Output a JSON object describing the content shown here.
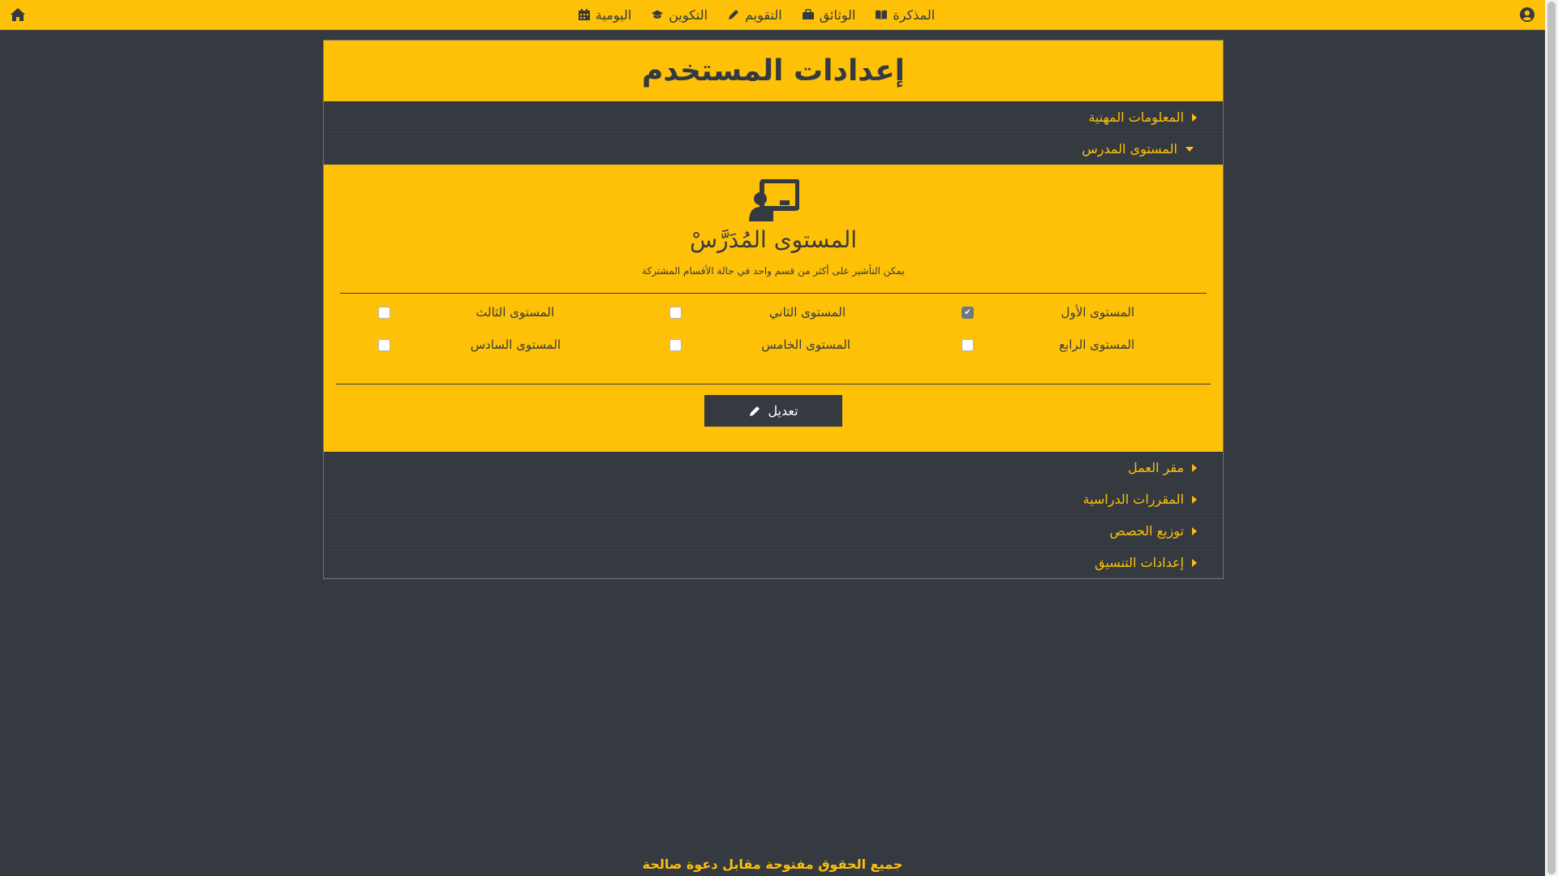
{
  "navbar": {
    "items": [
      {
        "label": "المذكرة",
        "icon": "book-icon"
      },
      {
        "label": "الوثائق",
        "icon": "briefcase-icon"
      },
      {
        "label": "التقويم",
        "icon": "pencil-icon"
      },
      {
        "label": "التكوين",
        "icon": "graduation-cap-icon"
      },
      {
        "label": "اليومية",
        "icon": "calendar-icon"
      }
    ]
  },
  "card": {
    "title": "إعدادات المستخدم",
    "sections_before": [
      {
        "label": "المعلومات المهنية"
      },
      {
        "label": "المستوى المدرس"
      }
    ],
    "panel": {
      "title": "المستوى المُدَرَّسْ",
      "subtitle": "يمكن التأشير على أكثر من قسم واحد في حالة الأقسام المشتركة",
      "levels": [
        {
          "label": "المستوى الأول",
          "checked": true
        },
        {
          "label": "المستوى الثاني",
          "checked": false
        },
        {
          "label": "المستوى الثالث",
          "checked": false
        },
        {
          "label": "المستوى الرابع",
          "checked": false
        },
        {
          "label": "المستوى الخامس",
          "checked": false
        },
        {
          "label": "المستوى السادس",
          "checked": false
        }
      ],
      "edit_label": "تعديل"
    },
    "sections_after": [
      {
        "label": "مقر العمل"
      },
      {
        "label": "المقررات الدراسية"
      },
      {
        "label": "توزيع الحصص"
      },
      {
        "label": "إعدادات التنسيق"
      }
    ]
  },
  "footer": "جميع الحقوق مفتوحة مقابل دعوة صالحة",
  "colors": {
    "accent": "#ffc107",
    "dark": "#343a40"
  }
}
